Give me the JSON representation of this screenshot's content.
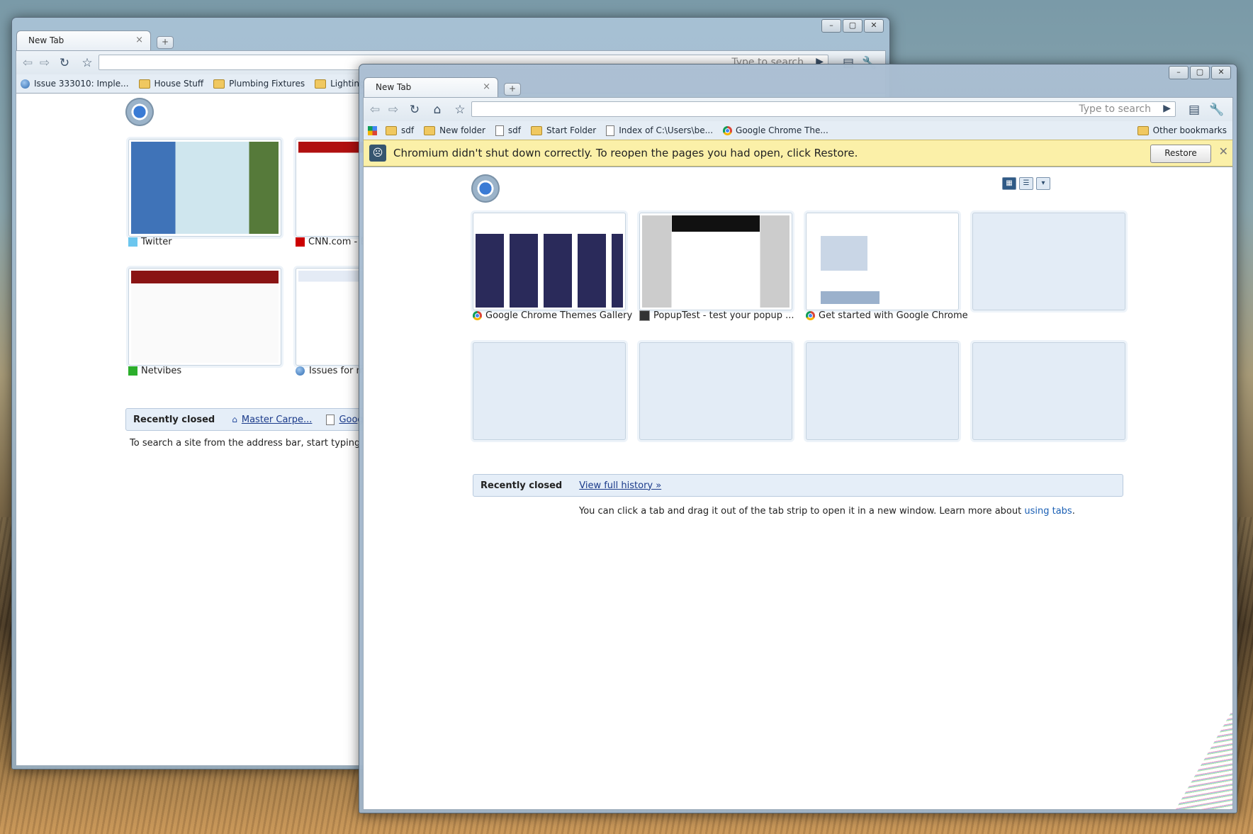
{
  "back_window": {
    "tab_title": "New Tab",
    "tab_close": "×",
    "newtab": "+",
    "omnibox_placeholder": "Type to search",
    "controls": {
      "min": "–",
      "max": "▢",
      "close": "✕"
    },
    "bookmarks": [
      {
        "label": "Issue 333010: Imple...",
        "icon": "globe-icon"
      },
      {
        "label": "House Stuff",
        "icon": "folder-icon"
      },
      {
        "label": "Plumbing Fixtures",
        "icon": "folder-icon"
      },
      {
        "label": "Lighting",
        "icon": "folder-icon"
      }
    ],
    "thumbnails": [
      {
        "title": "Twitter",
        "favicon": "twitter-icon"
      },
      {
        "title": "CNN.com - B",
        "favicon": "cnn-icon"
      },
      {
        "title": "Netvibes",
        "favicon": "netvibes-icon"
      },
      {
        "title": "Issues for m",
        "favicon": "globe-icon"
      }
    ],
    "recently_closed_label": "Recently closed",
    "recently_closed_items": [
      "Master Carpe...",
      "Google"
    ],
    "tip": "To search a site from the address bar, start typing the si"
  },
  "front_window": {
    "tab_title": "New Tab",
    "tab_close": "×",
    "newtab": "+",
    "omnibox_placeholder": "Type to search",
    "controls": {
      "min": "–",
      "max": "▢",
      "close": "✕"
    },
    "bookmarks": [
      {
        "label": "sdf",
        "icon": "folder-icon"
      },
      {
        "label": "New folder",
        "icon": "folder-icon"
      },
      {
        "label": "sdf",
        "icon": "page-icon"
      },
      {
        "label": "Start Folder",
        "icon": "folder-icon"
      },
      {
        "label": "Index of C:\\Users\\be...",
        "icon": "page-icon"
      },
      {
        "label": "Google Chrome The...",
        "icon": "chrome-icon"
      }
    ],
    "other_bookmarks": "Other bookmarks",
    "infobar": {
      "message": "Chromium didn't shut down correctly. To reopen the pages you had open, click Restore.",
      "button": "Restore",
      "close": "✕"
    },
    "thumbnails": [
      {
        "title": "Google Chrome Themes Gallery",
        "favicon": "chrome-icon"
      },
      {
        "title": "PopupTest - test your popup ...",
        "favicon": "pop-icon"
      },
      {
        "title": "Get started with Google Chrome",
        "favicon": "chrome-icon"
      }
    ],
    "recently_closed_label": "Recently closed",
    "view_history": "View full history »",
    "tip_text": "You can click a tab and drag it out of the tab strip to open it in a new window. Learn more about ",
    "tip_link": "using tabs",
    "tip_end": "."
  }
}
